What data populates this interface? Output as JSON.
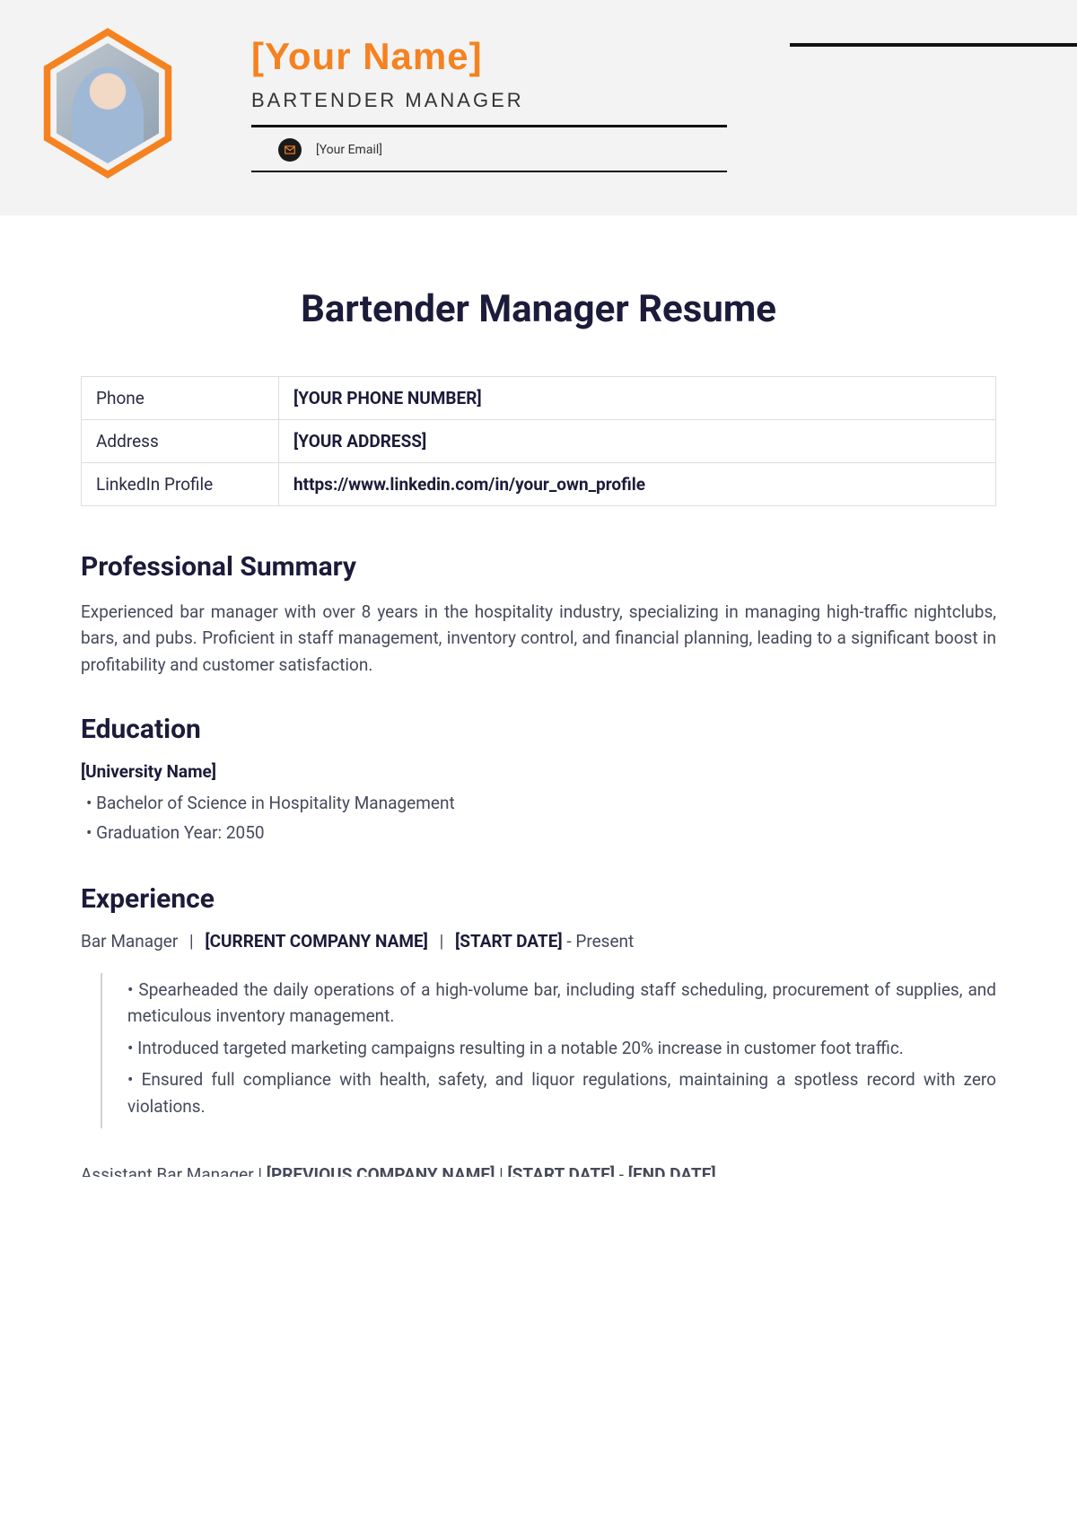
{
  "header": {
    "name": "[Your Name]",
    "role": "BARTENDER MANAGER",
    "email_label": "[Your Email]"
  },
  "title": "Bartender Manager Resume",
  "contact": {
    "rows": [
      {
        "label": "Phone",
        "value": "[YOUR PHONE NUMBER]"
      },
      {
        "label": "Address",
        "value": "[YOUR ADDRESS]"
      },
      {
        "label": "LinkedIn Profile",
        "value": "https://www.linkedin.com/in/your_own_profile"
      }
    ]
  },
  "sections": {
    "summary_heading": "Professional Summary",
    "summary_text": "Experienced bar manager with over 8 years in the hospitality industry, specializing in managing high-traffic nightclubs, bars, and pubs. Proficient in staff management, inventory control, and financial planning, leading to a significant boost in profitability and customer satisfaction.",
    "education_heading": "Education",
    "education_institution": "[University Name]",
    "education_items": [
      "Bachelor of Science in Hospitality Management",
      "Graduation Year: 2050"
    ],
    "experience_heading": "Experience",
    "exp1": {
      "role": "Bar Manager",
      "company": "[CURRENT COMPANY NAME]",
      "start": "[START DATE]",
      "end": "Present",
      "end_sep": " - ",
      "bullets": [
        "Spearheaded the daily operations of a high-volume bar, including staff scheduling, procurement of supplies, and meticulous inventory management.",
        "Introduced targeted marketing campaigns resulting in a notable 20% increase in customer foot traffic.",
        "Ensured full compliance with health, safety, and liquor regulations, maintaining a spotless record with zero violations."
      ]
    },
    "exp2_cutoff": {
      "role": "Assistant Bar Manager",
      "company": "[PREVIOUS COMPANY NAME]",
      "start": "[START DATE]",
      "end": "[END DATE]",
      "end_sep": " - "
    }
  },
  "sep_pipe": "|"
}
